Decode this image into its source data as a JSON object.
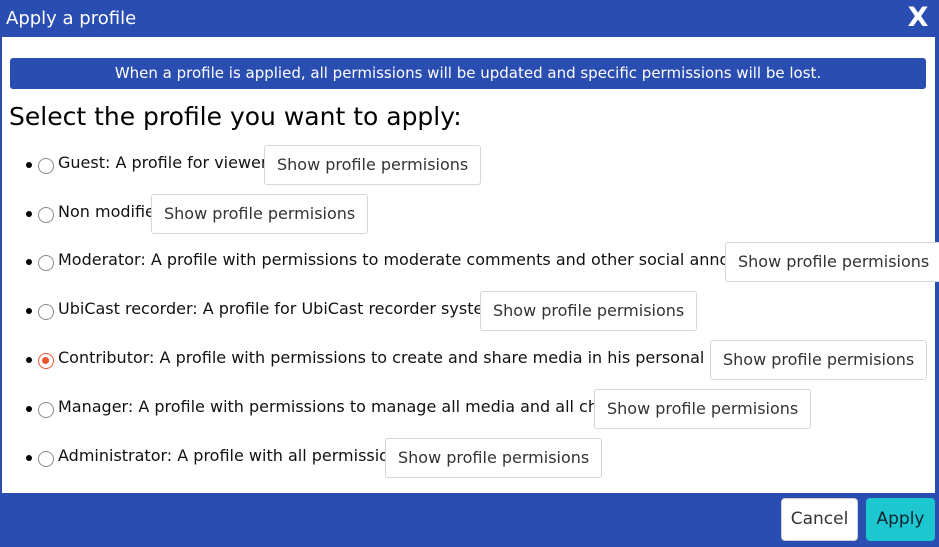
{
  "dialog": {
    "title": "Apply a profile",
    "close_label": "X"
  },
  "notice": "When a profile is applied, all permissions will be updated and specific permissions will be lost.",
  "heading": "Select the profile you want to apply:",
  "profiles": [
    {
      "label": "Guest: A profile for viewers.",
      "button": "Show profile permisions",
      "selected": false
    },
    {
      "label": "Non modifie",
      "button": "Show profile permisions",
      "selected": false
    },
    {
      "label": "Moderator: A profile with permissions to moderate comments and other social annotations.",
      "button": "Show profile permisions",
      "selected": false
    },
    {
      "label": "UbiCast recorder: A profile for UbiCast recorder systems.",
      "button": "Show profile permisions",
      "selected": false
    },
    {
      "label": "Contributor: A profile with permissions to create and share media in his personal channel.",
      "button": "Show profile permisions",
      "selected": true
    },
    {
      "label": "Manager: A profile with permissions to manage all media and all channels.",
      "button": "Show profile permisions",
      "selected": false
    },
    {
      "label": "Administrator: A profile with all permissions.",
      "button": "Show profile permisions",
      "selected": false
    }
  ],
  "footer": {
    "cancel_label": "Cancel",
    "apply_label": "Apply"
  },
  "colors": {
    "primary": "#2a4db1",
    "accent": "#1cc7d0",
    "radio_selected": "#e8552b"
  }
}
